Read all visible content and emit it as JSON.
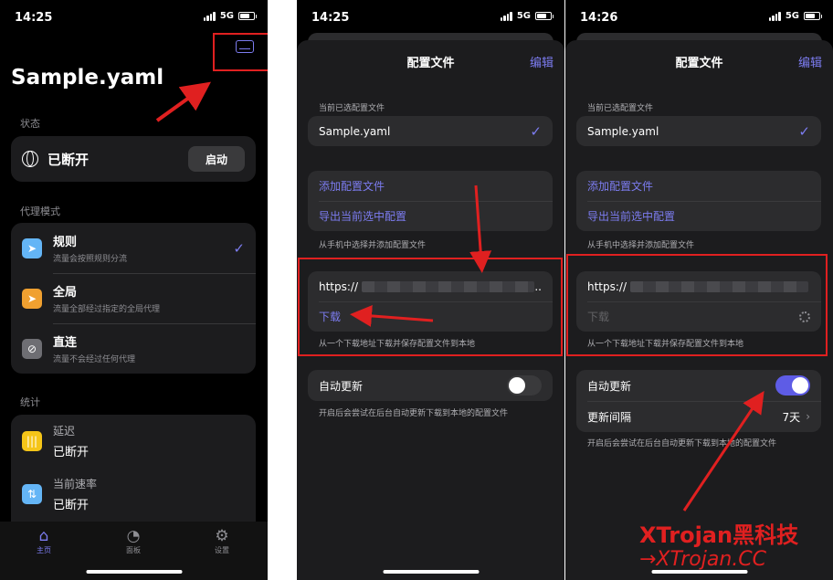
{
  "screens": [
    {
      "status": {
        "time": "14:25",
        "network": "5G"
      },
      "title": "Sample.yaml",
      "status_section": "状态",
      "connection": {
        "state": "已断开",
        "button": "启动"
      },
      "proxy_section": "代理模式",
      "modes": [
        {
          "title": "规则",
          "subtitle": "流量会按照规则分流",
          "icon": "send-icon",
          "color": "#64b5f6",
          "selected": true
        },
        {
          "title": "全局",
          "subtitle": "流量全部经过指定的全局代理",
          "icon": "send-icon",
          "color": "#f0a030",
          "selected": false
        },
        {
          "title": "直连",
          "subtitle": "流量不会经过任何代理",
          "icon": "no-send-icon",
          "color": "#6e6e73",
          "selected": false
        }
      ],
      "stats_section": "统计",
      "stats": [
        {
          "title": "延迟",
          "value": "已断开",
          "icon": "waveform-icon",
          "color": "#f5c518"
        },
        {
          "title": "当前速率",
          "value": "已断开",
          "icon": "arrows-updown-icon",
          "color": "#64b5f6"
        }
      ],
      "tabs": [
        {
          "label": "主页",
          "icon": "home-icon",
          "active": true
        },
        {
          "label": "面板",
          "icon": "gauge-icon",
          "active": false
        },
        {
          "label": "设置",
          "icon": "gear-icon",
          "active": false
        }
      ]
    },
    {
      "status": {
        "time": "14:25",
        "network": "5G"
      },
      "title": "配置文件",
      "edit": "编辑",
      "current_label": "当前已选配置文件",
      "current_file": "Sample.yaml",
      "add_config": "添加配置文件",
      "export_config": "导出当前选中配置",
      "add_hint": "从手机中选择并添加配置文件",
      "url_prefix": "https://",
      "url_suffix": "..",
      "download": "下载",
      "download_hint": "从一个下载地址下载并保存配置文件到本地",
      "auto_update": "自动更新",
      "auto_update_on": false,
      "auto_hint": "开启后会尝试在后台自动更新下载到本地的配置文件"
    },
    {
      "status": {
        "time": "14:26",
        "network": "5G"
      },
      "title": "配置文件",
      "edit": "编辑",
      "current_label": "当前已选配置文件",
      "current_file": "Sample.yaml",
      "add_config": "添加配置文件",
      "export_config": "导出当前选中配置",
      "add_hint": "从手机中选择并添加配置文件",
      "url_prefix": "https://",
      "download": "下载",
      "download_hint": "从一个下载地址下载并保存配置文件到本地",
      "auto_update": "自动更新",
      "auto_update_on": true,
      "interval_label": "更新间隔",
      "interval_value": "7天",
      "auto_hint": "开启后会尝试在后台自动更新下载到本地的配置文件"
    }
  ],
  "watermark": {
    "line1": "XTrojan黑科技",
    "line2": "→XTrojan.CC"
  },
  "colors": {
    "accent": "#7c7cf0",
    "annotation": "#e02020"
  }
}
